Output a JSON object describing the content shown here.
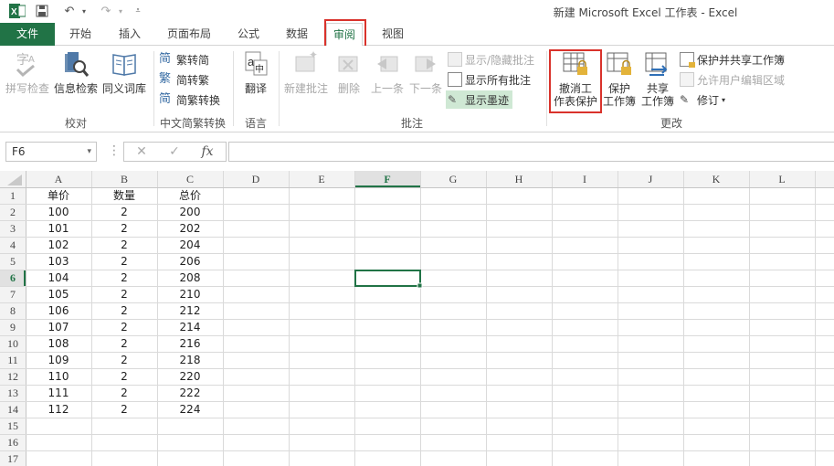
{
  "window": {
    "title": "新建 Microsoft Excel 工作表 - Excel"
  },
  "tabs": [
    {
      "label": "文件",
      "name": "tab-file"
    },
    {
      "label": "开始",
      "name": "tab-home"
    },
    {
      "label": "插入",
      "name": "tab-insert"
    },
    {
      "label": "页面布局",
      "name": "tab-page-layout"
    },
    {
      "label": "公式",
      "name": "tab-formulas"
    },
    {
      "label": "数据",
      "name": "tab-data"
    },
    {
      "label": "审阅",
      "name": "tab-review",
      "active": true
    },
    {
      "label": "视图",
      "name": "tab-view"
    }
  ],
  "ribbon": {
    "proofing": {
      "label": "校对",
      "spelling": "拼写检查",
      "research": "信息检索",
      "thesaurus": "同义词库"
    },
    "chinese": {
      "label": "中文简繁转换",
      "to_simplified": "繁转简",
      "to_traditional": "简转繁",
      "convert": "简繁转换"
    },
    "language": {
      "label": "语言",
      "translate": "翻译"
    },
    "comments": {
      "label": "批注",
      "new": "新建批注",
      "delete": "删除",
      "prev": "上一条",
      "next": "下一条",
      "show_hide": "显示/隐藏批注",
      "show_all": "显示所有批注",
      "show_ink": "显示墨迹"
    },
    "changes": {
      "label": "更改",
      "unprotect_sheet": [
        "撤消工",
        "作表保护"
      ],
      "protect_workbook": [
        "保护",
        "工作簿"
      ],
      "share_workbook": [
        "共享",
        "工作簿"
      ],
      "protect_share": "保护并共享工作簿",
      "allow_edit": "允许用户编辑区域",
      "track": "修订"
    }
  },
  "formula_bar": {
    "name_box": "F6",
    "cancel": "✕",
    "enter": "✓",
    "fx": "fx",
    "formula": ""
  },
  "sheet": {
    "columns": [
      "A",
      "B",
      "C",
      "D",
      "E",
      "F",
      "G",
      "H",
      "I",
      "J",
      "K",
      "L"
    ],
    "row_numbers": [
      "1",
      "2",
      "3",
      "4",
      "5",
      "6",
      "7",
      "8",
      "9",
      "10",
      "11",
      "12",
      "13",
      "14",
      "15",
      "16",
      "17"
    ],
    "rows": [
      [
        "单价",
        "数量",
        "总价"
      ],
      [
        "100",
        "2",
        "200"
      ],
      [
        "101",
        "2",
        "202"
      ],
      [
        "102",
        "2",
        "204"
      ],
      [
        "103",
        "2",
        "206"
      ],
      [
        "104",
        "2",
        "208"
      ],
      [
        "105",
        "2",
        "210"
      ],
      [
        "106",
        "2",
        "212"
      ],
      [
        "107",
        "2",
        "214"
      ],
      [
        "108",
        "2",
        "216"
      ],
      [
        "109",
        "2",
        "218"
      ],
      [
        "110",
        "2",
        "220"
      ],
      [
        "111",
        "2",
        "222"
      ],
      [
        "112",
        "2",
        "224"
      ]
    ],
    "selected_cell": {
      "col": "F",
      "row": "6"
    }
  },
  "colors": {
    "accent": "#217346",
    "highlight": "#d9322b",
    "ink_active": "#cfe8d4"
  }
}
